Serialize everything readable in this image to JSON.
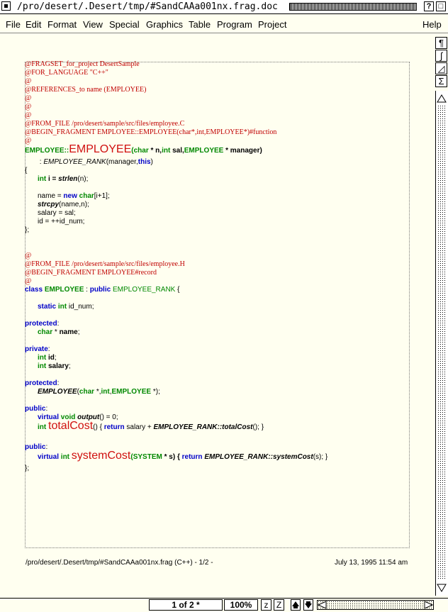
{
  "window": {
    "title": "/pro/desert/.Desert/tmp/#SandCAAa001nx.frag.doc",
    "help_glyph": "?",
    "close_glyph": "□"
  },
  "menu": [
    "File",
    "Edit",
    "Format",
    "View",
    "Special",
    "Graphics",
    "Table",
    "Program",
    "Project"
  ],
  "menu_help": "Help",
  "right_tools": [
    "¶",
    "∫",
    "◿",
    "Σ"
  ],
  "code": {
    "l1": "@FRAGSET_for_project DesertSample",
    "l2": "@FOR_LANGUAGE \"C++\"",
    "l3": "@",
    "l4": "@REFERENCES_to name (EMPLOYEE)",
    "l5": "@",
    "l6": "@",
    "l7": "@",
    "l8": "@FROM_FILE /pro/desert/sample/src/files/employee.C",
    "l9": "@BEGIN_FRAGMENT EMPLOYEE::EMPLOYEE(char*,int,EMPLOYEE*)#function",
    "l10": "@",
    "ctor_class": "EMPLOYEE::",
    "ctor_name": "EMPLOYEE",
    "ctor_open": "(",
    "ctor_char": "char",
    "ctor_p1": " * n,",
    "ctor_int": "int",
    "ctor_p2": " sal,",
    "ctor_emp": "EMPLOYEE",
    "ctor_p3": " * manager)",
    "init_colon": " : ",
    "init_call": "EMPLOYEE_RANK",
    "init_args1": "(manager,",
    "init_this": "this",
    "init_args2": ")",
    "brace_open": "{",
    "int_kw": "int",
    "i_decl": " i = ",
    "strlen": "strlen",
    "strlen_args": "(n);",
    "name_assign": "name = ",
    "new_kw": "new",
    "char_kw": "char",
    "new_rest": "[i+1];",
    "strcpy": "strcpy",
    "strcpy_args": "(name,n);",
    "salary_assign": "salary = sal;",
    "id_assign": "id = ++id_num;",
    "brace_close": "};",
    "l11": "@",
    "l12": "@FROM_FILE /pro/desert/sample/src/files/employee.H",
    "l13": "@BEGIN_FRAGMENT EMPLOYEE#record",
    "l14": "@",
    "class_kw": "class",
    "class_name": "EMPLOYEE",
    "class_colon": " : ",
    "public_kw": "public",
    "base_name": "EMPLOYEE_RANK",
    "class_brace": " {",
    "static_kw": "static",
    "static_int": "int",
    "static_rest": " id_num;",
    "protected1": "protected",
    "colon": ":",
    "char_kw2": "char",
    "name_decl": " * ",
    "name_var": "name",
    "semi": ";",
    "private_kw": "private",
    "int_id": "int",
    "id_var": "id",
    "int_salary": "int",
    "salary_var": "salary",
    "protected2": "protected",
    "emp_proto": "EMPLOYEE",
    "proto_open": "(",
    "proto_char": "char",
    "proto_mid": " *,",
    "proto_int": "int",
    "proto_comma": ",",
    "proto_emp": "EMPLOYEE",
    "proto_end": " *);",
    "public2": "public",
    "virtual_kw": "virtual",
    "void_kw": "void",
    "output_fn": "output",
    "output_rest": "() = 0;",
    "tc_int": "int",
    "tc_name": "totalCost",
    "tc_mid": "() { ",
    "return_kw": "return",
    "tc_body1": " salary + ",
    "tc_call": "EMPLOYEE_RANK::totalCost",
    "tc_end": "(); }",
    "public3": "public",
    "sc_virtual": "virtual",
    "sc_int": "int",
    "sc_name": "systemCost",
    "sc_open": "(",
    "sc_sys": "SYSTEM",
    "sc_p": " * s) { ",
    "sc_return": "return",
    "sc_call": "EMPLOYEE_RANK::systemCost",
    "sc_end": "(s); }",
    "class_close": "};"
  },
  "footer": {
    "left": "/pro/desert/.Desert/tmp/#SandCAAa001nx.frag (C++) - 1/2 -",
    "right": "July 13, 1995 11:54 am"
  },
  "status": {
    "page": "1 of 2 *",
    "zoom": "100%",
    "z_label": "z",
    "Z_label": "Z"
  }
}
